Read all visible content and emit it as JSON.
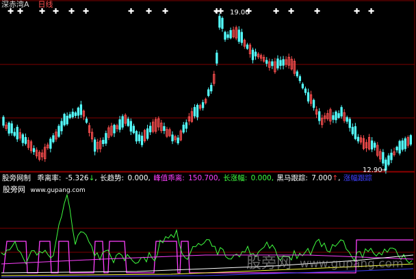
{
  "header": {
    "market": "深赤湾A",
    "period": "日线"
  },
  "price_panel": {
    "high_label": "19.00",
    "low_label": "12.90",
    "high_arrow": "←",
    "low_arrow": "→"
  },
  "indicator": {
    "name": "股旁网制",
    "deviation_label": "乖离率:",
    "deviation_value": "-5.326",
    "deviation_arrow": "↓",
    "trend_label": "长趋势:",
    "trend_value": "0.000",
    "peak_label": "峰值乖离:",
    "peak_value": "150.700",
    "rise_label": "长涨幅:",
    "rise_value": "0.000",
    "dark_label": "黑马跟踪:",
    "dark_value": "7.000",
    "dark_arrow": "↑",
    "last_label": "涨幅跟踪",
    "source_name": "股旁网",
    "source_url": "www.gupang.com"
  },
  "watermark": {
    "cn": "股旁网",
    "url": "www.gupang.com"
  },
  "colors": {
    "up": "#ff5050",
    "down": "#54ffff",
    "grid": "#800000",
    "green": "#40ff40",
    "magenta": "#ff40ff",
    "yellow": "#ffff40",
    "white": "#ffffff",
    "blue": "#4040ff"
  }
}
